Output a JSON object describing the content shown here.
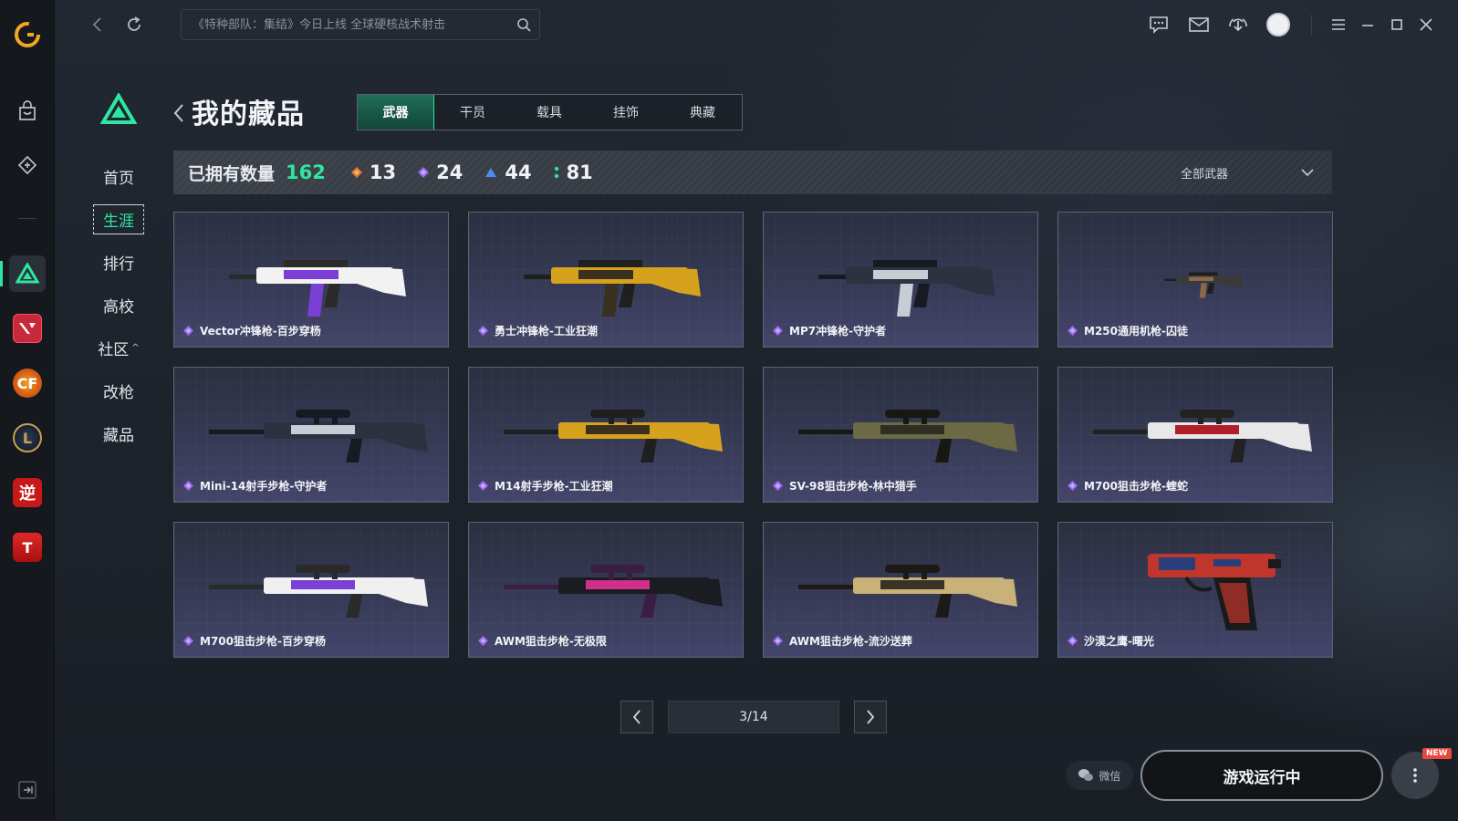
{
  "search": {
    "placeholder": "《特种部队：集结》今日上线 全球硬核战术射击"
  },
  "subnav": {
    "items": [
      {
        "label": "首页"
      },
      {
        "label": "生涯"
      },
      {
        "label": "排行"
      },
      {
        "label": "高校"
      },
      {
        "label": "社区"
      },
      {
        "label": "改枪"
      },
      {
        "label": "藏品"
      }
    ],
    "active_index": 1,
    "community_caret": "^"
  },
  "header": {
    "title": "我的藏品"
  },
  "tabs": [
    {
      "label": "武器",
      "active": true
    },
    {
      "label": "干员",
      "active": false
    },
    {
      "label": "载具",
      "active": false
    },
    {
      "label": "挂饰",
      "active": false
    },
    {
      "label": "典藏",
      "active": false
    }
  ],
  "stats": {
    "label": "已拥有数量",
    "total": "162",
    "counts": [
      {
        "value": "13",
        "color": "#e07a2e"
      },
      {
        "value": "24",
        "color": "#9b6bf2"
      },
      {
        "value": "44",
        "color": "#4a8df0"
      },
      {
        "value": "81",
        "color": "#2ee6a0"
      }
    ],
    "filter_label": "全部武器"
  },
  "items": [
    {
      "name": "Vector冲锋枪-百步穿杨",
      "gun": "smg",
      "palette": [
        "#f2f2f2",
        "#7b3fd6",
        "#2a2a2a"
      ]
    },
    {
      "name": "勇士冲锋枪-工业狂潮",
      "gun": "smg2",
      "palette": [
        "#d6a21e",
        "#3a3020",
        "#1f1f1f"
      ]
    },
    {
      "name": "MP7冲锋枪-守护者",
      "gun": "smg3",
      "palette": [
        "#2c3240",
        "#c8ccd4",
        "#171a20"
      ]
    },
    {
      "name": "M250通用机枪-囚徒",
      "gun": "mg",
      "palette": [
        "#3a3a3a",
        "#8a6a4a",
        "#1e1e1e"
      ]
    },
    {
      "name": "Mini-14射手步枪-守护者",
      "gun": "dmr",
      "palette": [
        "#2c3240",
        "#c8ccd4",
        "#171a20"
      ]
    },
    {
      "name": "M14射手步枪-工业狂潮",
      "gun": "dmr2",
      "palette": [
        "#d6a21e",
        "#3a3020",
        "#1f1f1f"
      ]
    },
    {
      "name": "SV-98狙击步枪-林中猎手",
      "gun": "sniper",
      "palette": [
        "#6b6a44",
        "#2e2e22",
        "#181812"
      ]
    },
    {
      "name": "M700狙击步枪-蝰蛇",
      "gun": "sniper2",
      "palette": [
        "#e8e8e8",
        "#b01f2a",
        "#222222"
      ]
    },
    {
      "name": "M700狙击步枪-百步穿杨",
      "gun": "sniper3",
      "palette": [
        "#f0f0f0",
        "#7b3fd6",
        "#2a2a2a"
      ]
    },
    {
      "name": "AWM狙击步枪-无极限",
      "gun": "awm",
      "palette": [
        "#1b1b22",
        "#d0308a",
        "#3a1e46"
      ]
    },
    {
      "name": "AWM狙击步枪-流沙送葬",
      "gun": "awm2",
      "palette": [
        "#c9b27a",
        "#3a3226",
        "#1b1a16"
      ]
    },
    {
      "name": "沙漠之鹰-曙光",
      "gun": "pistol",
      "palette": [
        "#c0362c",
        "#2a3f7a",
        "#1a1a1a"
      ]
    }
  ],
  "rarity_color": "#9b6bf2",
  "pagination": {
    "label": "3/14"
  },
  "footer": {
    "wechat_label": "微信",
    "running_label": "游戏运行中",
    "new_badge": "NEW"
  },
  "accent": "#2ee6a0"
}
